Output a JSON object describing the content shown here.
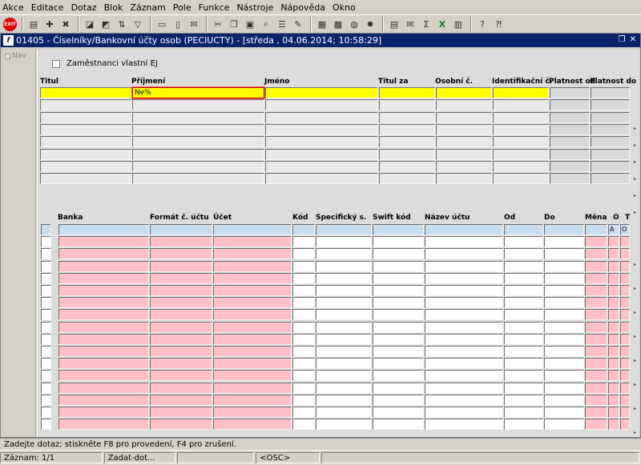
{
  "menu": [
    "Akce",
    "Editace",
    "Dotaz",
    "Blok",
    "Záznam",
    "Pole",
    "Funkce",
    "Nástroje",
    "Nápověda",
    "Okno"
  ],
  "toolbar": {
    "exit_label": "EXIT",
    "icons": [
      "save-icon",
      "new-icon",
      "delete-icon",
      "clear-icon",
      "enter-query-icon",
      "sort-icon",
      "filter-icon",
      "print-icon",
      "attach-icon",
      "mail-icon",
      "cut-icon",
      "copy-icon",
      "paste-icon",
      "find-icon",
      "list-icon",
      "edit-icon",
      "calc-icon",
      "calendar-icon",
      "globe-icon",
      "settings-icon",
      "report-icon",
      "mail-merge-icon",
      "sum-icon",
      "excel-icon",
      "chart-icon",
      "help-icon",
      "whats-this-icon"
    ]
  },
  "window": {
    "title": "01405 - Číselníky/Bankovní účty osob (PECIUCTY) - [středa , 04.06.2014; 10:58:29]",
    "nav_label": "Nav"
  },
  "upper": {
    "checkbox_label": "Zaměstnanci vlastní EJ",
    "headers": [
      "Titul",
      "Příjmení",
      "Jméno",
      "Titul za",
      "Osobní č.",
      "Identifikační č.",
      "Platnost od",
      "Platnost do"
    ],
    "query_value": "Ne%"
  },
  "lower": {
    "headers": [
      "Banka",
      "Formát č. účtu",
      "Účet",
      "Kód",
      "Specifický s.",
      "Swift kód",
      "Název účtu",
      "Od",
      "Do",
      "Měna",
      "O",
      "T"
    ],
    "first_row_o": "A",
    "first_row_t": "O"
  },
  "status": {
    "message": "Zadejte dotaz; stiskněte F8 pro provedení, F4 pro zrušení.",
    "record": "Záznam: 1/1",
    "mode": "Zadat-dot...",
    "osc": "<OSC>"
  }
}
